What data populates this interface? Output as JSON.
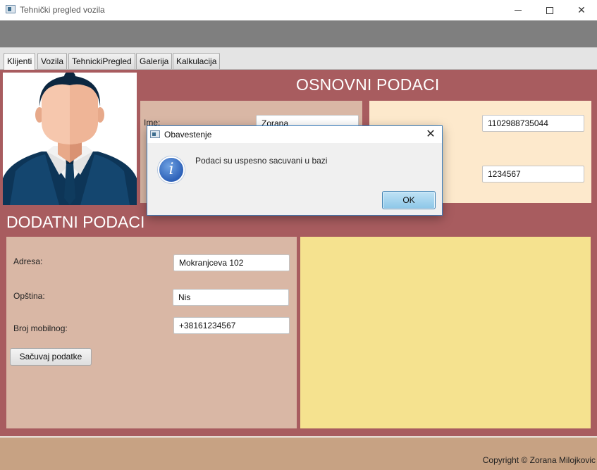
{
  "window": {
    "title": "Tehnički pregled vozila"
  },
  "tabs": [
    {
      "label": "Klijenti"
    },
    {
      "label": "Vozila"
    },
    {
      "label": "TehnickiPregled"
    },
    {
      "label": "Galerija"
    },
    {
      "label": "Kalkulacija"
    }
  ],
  "basic": {
    "heading": "OSNOVNI PODACI",
    "ime_label": "Ime:",
    "ime_value": "Zorana",
    "jmbg_value": "1102988735044",
    "second_value": "1234567"
  },
  "extra": {
    "heading": "DODATNI PODACI",
    "adresa_label": "Adresa:",
    "adresa_value": "Mokranjceva 102",
    "opstina_label": "Opština:",
    "opstina_value": "Nis",
    "mobilni_label": "Broj mobilnog:",
    "mobilni_value": "+38161234567",
    "save_button": "Sačuvaj podatke"
  },
  "footer": {
    "copyright": "Copyright  ©  Zorana Milojkovic"
  },
  "dialog": {
    "title": "Obavestenje",
    "message": "Podaci su uspesno sacuvani u bazi",
    "ok_button": "OK",
    "icon": "info-icon"
  },
  "colors": {
    "content_bg": "#a85c5f",
    "panel_tan": "#d9b7a5",
    "panel_cream": "#fde9cc",
    "panel_yellow": "#f5e28f",
    "footer_bg": "#c7a283"
  }
}
